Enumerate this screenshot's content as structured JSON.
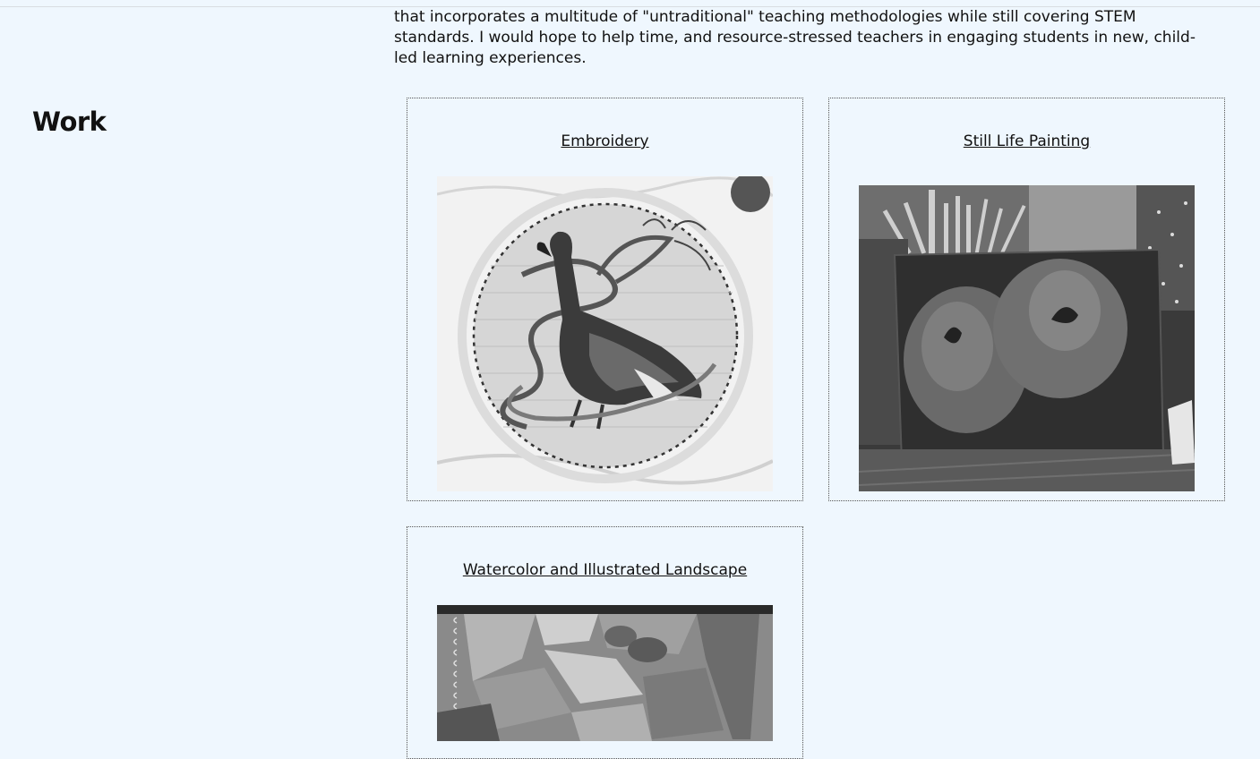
{
  "intro": {
    "line1": "that incorporates a multitude of \"untraditional\" teaching methodologies while still covering STEM",
    "line2": "standards. I would hope to help time, and resource-stressed teachers in engaging students in new, child-",
    "line3": "led learning experiences."
  },
  "work": {
    "title": "Work",
    "items": [
      {
        "title": "Embroidery",
        "image": "embroidery-goose-photo"
      },
      {
        "title": "Still Life Painting",
        "image": "still-life-pomegranates-photo"
      },
      {
        "title": "Watercolor and Illustrated Landscape",
        "image": "watercolor-landscape-sketchbook-photo"
      }
    ]
  },
  "colors": {
    "background": "#eff7fe",
    "text": "#111111",
    "card_border": "#555555"
  }
}
